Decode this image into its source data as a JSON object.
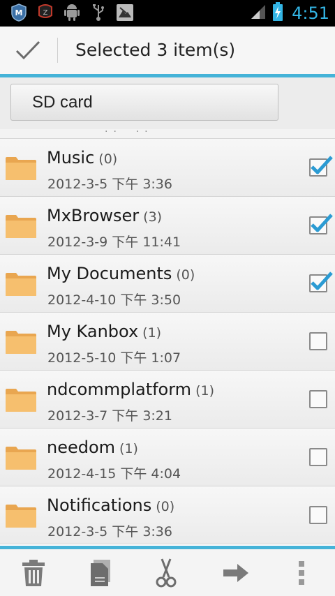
{
  "status_bar": {
    "icons": [
      "maxthon-icon",
      "zhihu-icon",
      "android-debug-icon",
      "usb-icon",
      "image-icon"
    ],
    "time": "4:51"
  },
  "action_bar": {
    "title": "Selected 3 item(s)"
  },
  "path": {
    "label": "SD card"
  },
  "files": [
    {
      "name": "Music",
      "count": "(0)",
      "date": "2012-3-5 下午 3:36",
      "checked": true
    },
    {
      "name": "MxBrowser",
      "count": "(3)",
      "date": "2012-3-9 下午 11:41",
      "checked": true
    },
    {
      "name": "My Documents",
      "count": "(0)",
      "date": "2012-4-10 下午 3:50",
      "checked": true
    },
    {
      "name": "My Kanbox",
      "count": "(1)",
      "date": "2012-5-10 下午 1:07",
      "checked": false
    },
    {
      "name": "ndcommplatform",
      "count": "(1)",
      "date": "2012-3-7 下午 3:21",
      "checked": false
    },
    {
      "name": "needom",
      "count": "(1)",
      "date": "2012-4-15 下午 4:04",
      "checked": false
    },
    {
      "name": "Notifications",
      "count": "(0)",
      "date": "2012-3-5 下午 3:36",
      "checked": false
    }
  ],
  "bottom_bar": {
    "actions": [
      "delete",
      "copy",
      "cut",
      "move",
      "more"
    ]
  },
  "colors": {
    "accent": "#33b5e5",
    "divider": "#45b3d8",
    "folder": "#f2b25a",
    "check": "#2b9bd3"
  }
}
